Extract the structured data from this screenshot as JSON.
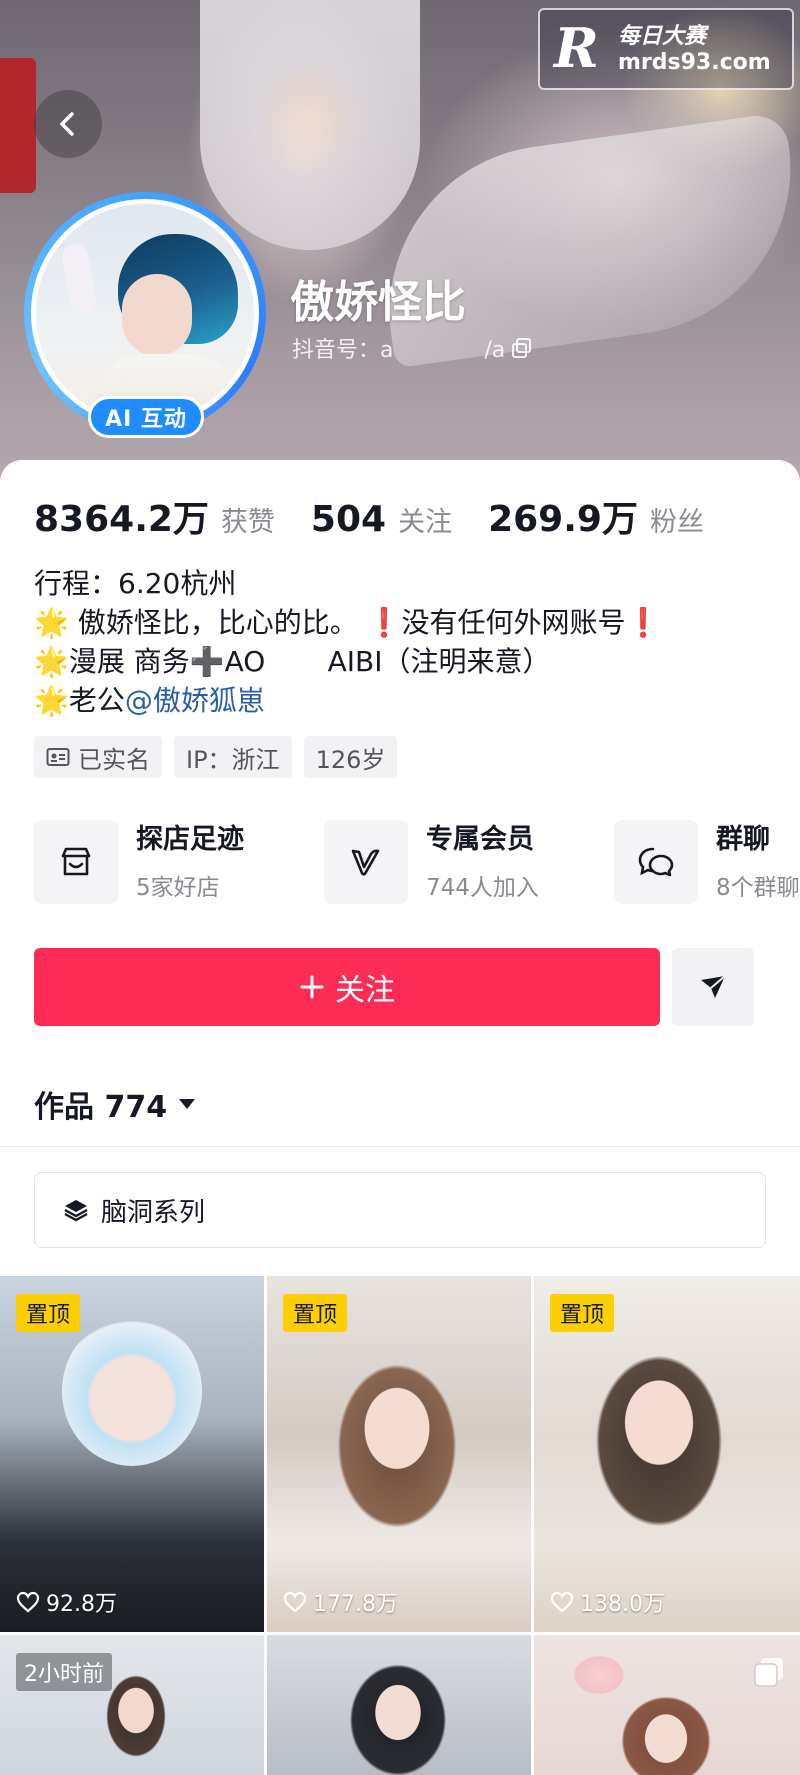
{
  "watermark": {
    "logo": "R",
    "title": "每日大赛",
    "url": "mrds93.com"
  },
  "profile": {
    "nickname": "傲娇怪比",
    "douyin_id": "抖音号：a             /a",
    "ai_badge": "AI 互动"
  },
  "stats": [
    {
      "value": "8364.2万",
      "label": "获赞"
    },
    {
      "value": "504",
      "label": "关注"
    },
    {
      "value": "269.9万",
      "label": "粉丝"
    }
  ],
  "bio": {
    "line1": "行程：6.20杭州",
    "line2": "🌟 傲娇怪比，比心的比。  ❗没有任何外网账号❗",
    "line3": "🌟漫展 商务➕AO       AIBI（注明来意）",
    "line4_prefix": "🌟老公",
    "line4_mention": "@傲娇狐崽"
  },
  "tags": [
    "已实名",
    "IP：浙江",
    "126岁"
  ],
  "features": [
    {
      "title": "探店足迹",
      "subtitle": "5家好店",
      "icon": "shop-icon"
    },
    {
      "title": "专属会员",
      "subtitle": "744人加入",
      "icon": "vip-v-icon"
    },
    {
      "title": "群聊",
      "subtitle": "8个群聊",
      "icon": "chat-bubbles-icon"
    }
  ],
  "actions": {
    "follow_label": "关注",
    "share_icon": "send-icon"
  },
  "works_tab": {
    "label": "作品 774"
  },
  "series": {
    "label": "脑洞系列"
  },
  "videos": [
    {
      "badge": "置顶",
      "likes": "92.8万"
    },
    {
      "badge": "置顶",
      "likes": "177.8万"
    },
    {
      "badge": "置顶",
      "likes": "138.0万"
    },
    {
      "badge": "2小时前",
      "likes": ""
    },
    {
      "badge": "",
      "likes": ""
    },
    {
      "badge": "",
      "likes": ""
    }
  ],
  "colors": {
    "follow": "#fe2c55",
    "mention": "#2a5ea8",
    "pin": "#fcd000",
    "ai_badge": "#1f8cff"
  }
}
